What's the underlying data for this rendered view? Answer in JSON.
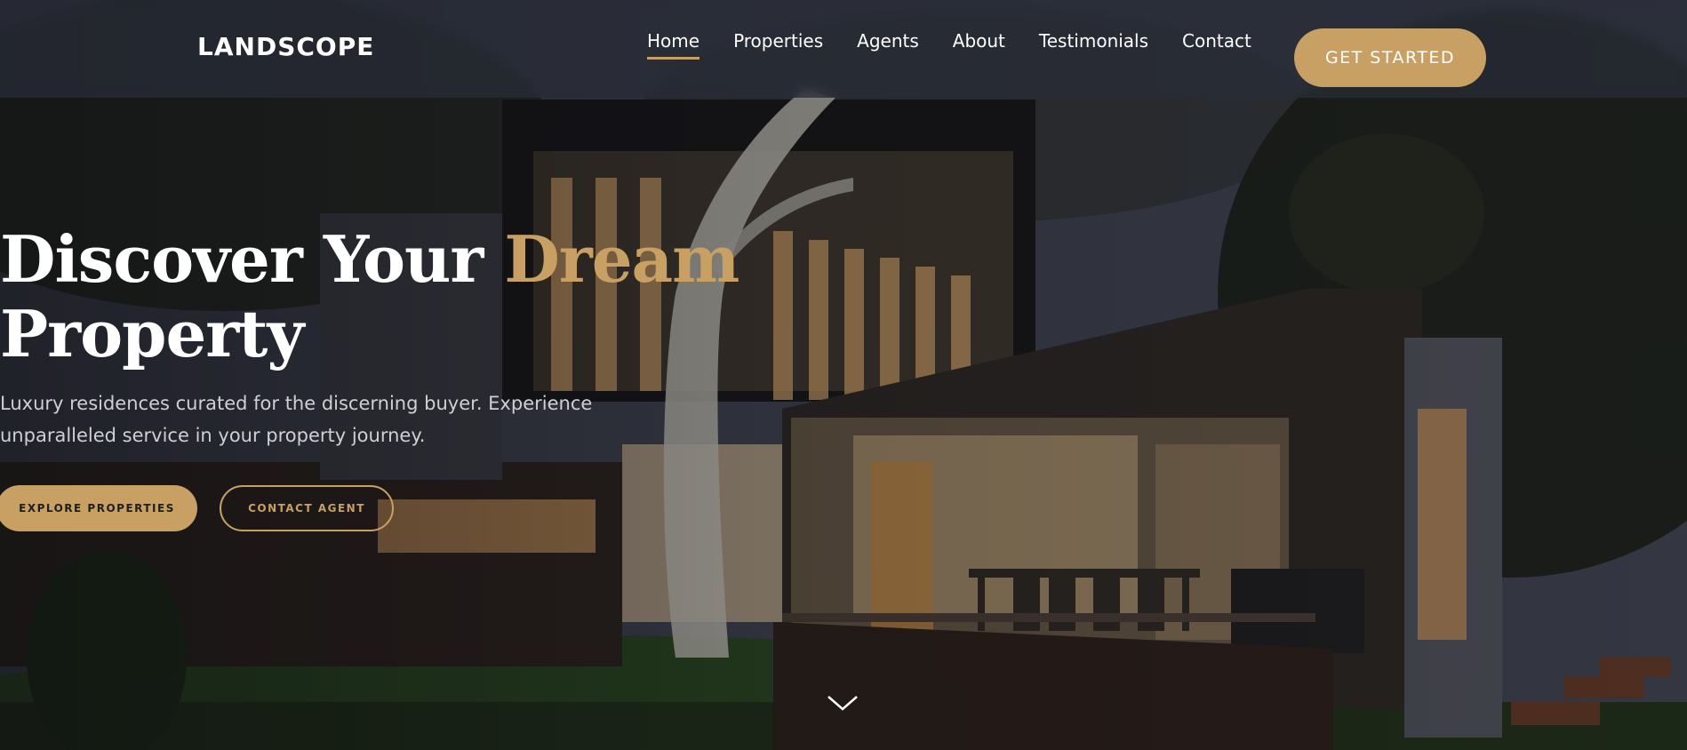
{
  "header": {
    "logo": "LANDSCOPE",
    "nav": [
      {
        "label": "Home",
        "active": true
      },
      {
        "label": "Properties",
        "active": false
      },
      {
        "label": "Agents",
        "active": false
      },
      {
        "label": "About",
        "active": false
      },
      {
        "label": "Testimonials",
        "active": false
      },
      {
        "label": "Contact",
        "active": false
      }
    ],
    "cta_label": "GET STARTED"
  },
  "hero": {
    "headline_part1": "Discover Your ",
    "headline_accent": "Dream",
    "headline_part2": "Property",
    "subtext": "Luxury residences curated for the discerning buyer. Experience unparalleled service in your property journey.",
    "primary_button": "EXPLORE PROPERTIES",
    "secondary_button": "CONTACT AGENT",
    "scroll_icon": "chevron-down-icon"
  },
  "colors": {
    "accent": "#c9a063",
    "text": "#ffffff",
    "muted": "#cfcfd4"
  }
}
